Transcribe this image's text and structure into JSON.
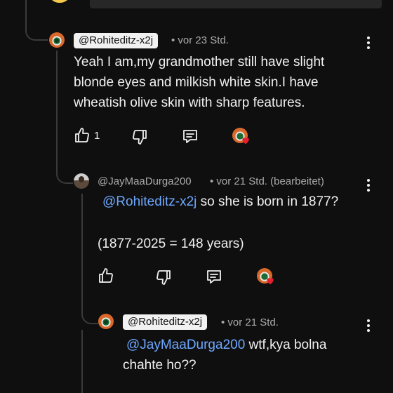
{
  "comments": [
    {
      "author": "@Rohiteditz-x2j",
      "time": "• vor 23 Std.",
      "lines": [
        "Yeah I am,my grandmother still have slight",
        "blonde eyes and milkish white skin.I have",
        "wheatish olive skin with sharp features."
      ],
      "like_count": "1"
    },
    {
      "author": "@JayMaaDurga200",
      "time": "• vor 21 Std. (bearbeitet)",
      "mention": "@Rohiteditz-x2j",
      "line1_rest": " so she is born in 1877?",
      "line2": "(1877-2025 = 148 years)"
    },
    {
      "author": "@Rohiteditz-x2j",
      "time": "• vor 21 Std.",
      "mention": "@JayMaaDurga200",
      "line1_rest": " wtf,kya bolna",
      "line2": "chahte ho??"
    }
  ],
  "icons": {
    "like": "thumbs-up-icon",
    "dislike": "thumbs-down-icon",
    "reply": "reply-icon",
    "more": "more-vertical-icon",
    "creator_heart": "creator-heart-icon"
  },
  "colors": {
    "background": "#0f0f0f",
    "text": "#f1f1f1",
    "meta": "#aaaaaa",
    "mention": "#6ea8ff",
    "heart": "#e5202e"
  }
}
